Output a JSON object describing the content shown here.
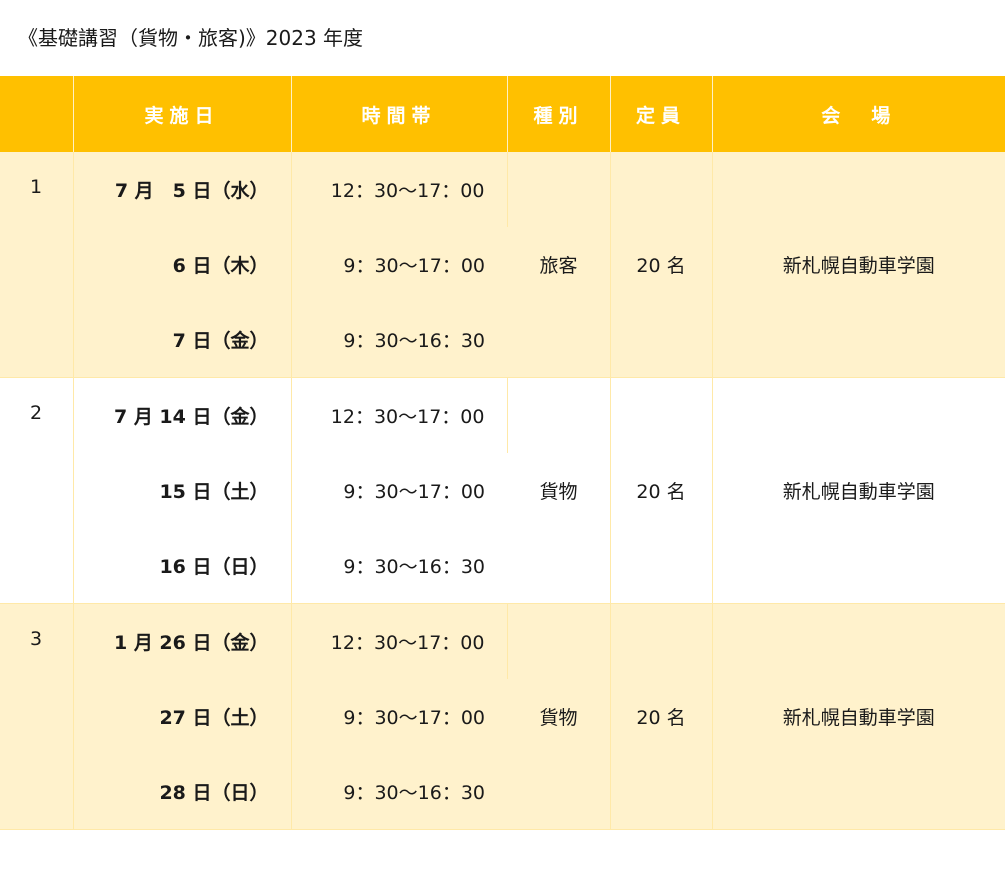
{
  "title": "《基礎講習（貨物・旅客)》2023 年度",
  "headers": {
    "num": "",
    "date": "実施日",
    "time": "時間帯",
    "type": "種別",
    "capacity": "定員",
    "venue": "会　場"
  },
  "groups": [
    {
      "num": "1",
      "type": "旅客",
      "capacity": "20 名",
      "venue": "新札幌自動車学園",
      "rows": [
        {
          "date": "7 月　5 日（水）",
          "time": "12：30〜17：00"
        },
        {
          "date": "6 日（木）",
          "time": "9：30〜17：00"
        },
        {
          "date": "7 日（金）",
          "time": "9：30〜16：30"
        }
      ]
    },
    {
      "num": "2",
      "type": "貨物",
      "capacity": "20 名",
      "venue": "新札幌自動車学園",
      "rows": [
        {
          "date": "7 月 14 日（金）",
          "time": "12：30〜17：00"
        },
        {
          "date": "15 日（土）",
          "time": "9：30〜17：00"
        },
        {
          "date": "16 日（日）",
          "time": "9：30〜16：30"
        }
      ]
    },
    {
      "num": "3",
      "type": "貨物",
      "capacity": "20 名",
      "venue": "新札幌自動車学園",
      "rows": [
        {
          "date": "1 月 26 日（金）",
          "time": "12：30〜17：00"
        },
        {
          "date": "27 日（土）",
          "time": "9：30〜17：00"
        },
        {
          "date": "28 日（日）",
          "time": "9：30〜16：30"
        }
      ]
    }
  ],
  "colors": {
    "header_bg": "#ffc000",
    "header_text": "#ffffff",
    "row_alt_bg": "#fff2cc",
    "row_bg": "#ffffff"
  }
}
